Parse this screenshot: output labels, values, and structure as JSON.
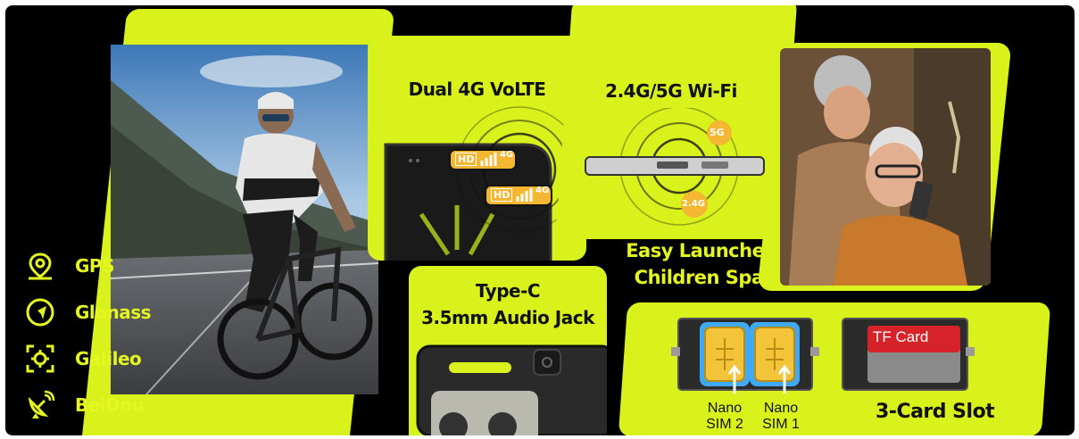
{
  "navigation": [
    {
      "label": "GPS",
      "icon": "map-pin-icon"
    },
    {
      "label": "Glonass",
      "icon": "navigation-arrow-icon"
    },
    {
      "label": "Galileo",
      "icon": "crosshair-target-icon"
    },
    {
      "label": "BeiDou",
      "icon": "satellite-dish-icon"
    }
  ],
  "features": {
    "dual_volte": "Dual 4G VoLTE",
    "wifi": "2.4G/5G Wi-Fi",
    "type_c": "Type-C",
    "audio_jack": "3.5mm Audio Jack",
    "launcher_line1": "Easy Launcher &",
    "launcher_line2": "Children Space",
    "card_slot": "3-Card Slot"
  },
  "badges": {
    "hd": "HD",
    "lte": "4G",
    "wifi_5g": "5G",
    "wifi_24g": "2.4G"
  },
  "sim": {
    "sim2_line1": "Nano",
    "sim2_line2": "SIM 2",
    "sim1_line1": "Nano",
    "sim1_line2": "SIM 1",
    "tf_card": "TF Card"
  },
  "colors": {
    "accent": "#d9f21c",
    "background": "#000000",
    "badge": "#f5b731",
    "tf_red": "#d6232a"
  }
}
